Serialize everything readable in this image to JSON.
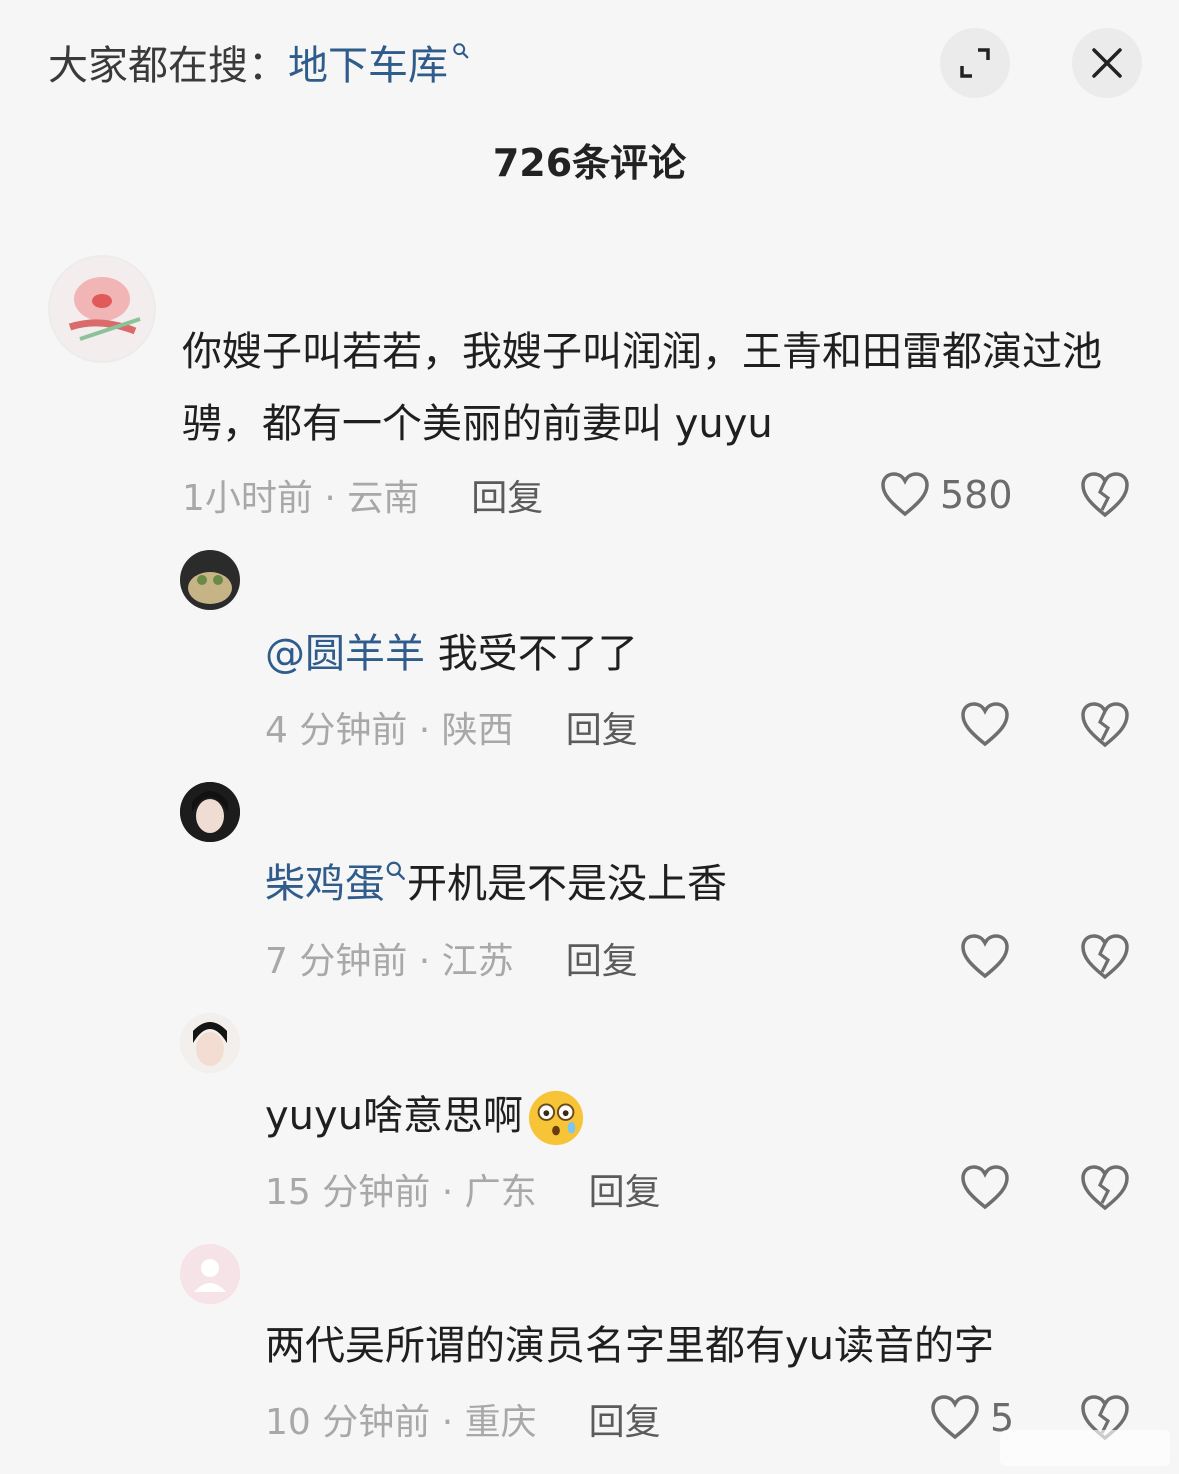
{
  "header": {
    "search_prefix": "大家都在搜：",
    "search_term": "地下车库",
    "comment_count": "726条评论",
    "expand_icon": "expand-icon",
    "close_icon": "close-icon"
  },
  "comments": [
    {
      "text": "你嫂子叫若若，我嫂子叫润润，王青和田雷都演过池骋，都有一个美丽的前妻叫 yuyu",
      "time_location": "1小时前 · 云南",
      "reply_label": "回复",
      "likes": "580"
    }
  ],
  "replies": [
    {
      "mention": "@圆羊羊",
      "text": " 我受不了了",
      "time_location": "4 分钟前 · 陕西",
      "reply_label": "回复",
      "likes": ""
    },
    {
      "username": "柴鸡蛋",
      "text": "开机是不是没上香",
      "time_location": "7 分钟前 · 江苏",
      "reply_label": "回复",
      "likes": ""
    },
    {
      "text": "yuyu啥意思啊",
      "emoji": "flushed-face-emoji",
      "time_location": "15 分钟前 · 广东",
      "reply_label": "回复",
      "likes": ""
    },
    {
      "text": "两代吴所谓的演员名字里都有yu读音的字",
      "time_location": "10 分钟前 · 重庆",
      "reply_label": "回复",
      "likes": "5"
    }
  ],
  "colors": {
    "link_blue": "#2f5c8a",
    "meta_gray": "#a8a8a8",
    "background": "#f6f6f6"
  }
}
